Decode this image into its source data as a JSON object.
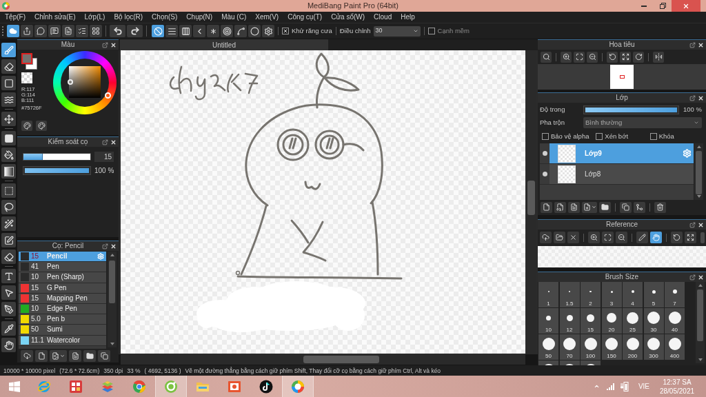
{
  "window": {
    "title": "MediBang Paint Pro (64bit)"
  },
  "menu": [
    "Tệp(F)",
    "Chỉnh sửa(E)",
    "Lớp(L)",
    "Bộ lọc(R)",
    "Chọn(S)",
    "Chụp(N)",
    "Màu (C)",
    "Xem(V)",
    "Công cụ(T)",
    "Cửa sổ(W)",
    "Cloud",
    "Help"
  ],
  "toolbar": {
    "snap_modes": [
      {
        "selected": true
      },
      {
        "selected": false
      },
      {
        "selected": false
      },
      {
        "selected": false
      },
      {
        "selected": false
      },
      {
        "selected": false
      },
      {
        "selected": false
      },
      {
        "selected": false
      },
      {
        "selected": false
      }
    ],
    "antialias": {
      "label": "Khử răng cưa",
      "checked": true
    },
    "correction": {
      "label": "Điều chỉnh",
      "value": "30"
    },
    "soft_edge": {
      "label": "Cạnh mềm",
      "checked": false
    }
  },
  "tools": [
    {
      "selected": true
    },
    {
      "selected": false
    },
    {
      "selected": false
    },
    {
      "selected": false
    },
    {
      "selected": false
    },
    {
      "selected": false
    },
    {
      "selected": false
    },
    {
      "selected": false
    },
    {
      "selected": false
    },
    {
      "selected": false
    },
    {
      "selected": false
    },
    {
      "selected": false
    },
    {
      "selected": false
    },
    {
      "selected": false
    },
    {
      "selected": false
    },
    {
      "selected": false
    },
    {
      "selected": false
    },
    {
      "selected": false
    }
  ],
  "color_panel": {
    "title": "Màu",
    "swatches": [
      {
        "kind": "foreground",
        "color": "#75726f",
        "selected": true
      },
      {
        "kind": "background",
        "color": "#ffffff",
        "selected": false
      }
    ],
    "red": "R:117",
    "green": "G:114",
    "blue": "B:111",
    "hex": "#75726F"
  },
  "brush_control": {
    "title": "Kiểm soát cọ",
    "size": {
      "level": 0.29,
      "value": "15"
    },
    "opacity": {
      "level": 1,
      "reading": "100 %"
    }
  },
  "brush_panel": {
    "title": "Cọ: Pencil",
    "brushes": [
      {
        "size": "15",
        "name": "Pencil",
        "color": "#2a2a2a",
        "selected": true
      },
      {
        "size": "41",
        "name": "Pen",
        "color": "#2a2a2a",
        "selected": false
      },
      {
        "size": "10",
        "name": "Pen (Sharp)",
        "color": "#2a2a2a",
        "selected": false
      },
      {
        "size": "15",
        "name": "G Pen",
        "color": "#ee3333",
        "selected": false
      },
      {
        "size": "15",
        "name": "Mapping Pen",
        "color": "#ee3333",
        "selected": false
      },
      {
        "size": "10",
        "name": "Edge Pen",
        "color": "#22aa22",
        "selected": false
      },
      {
        "size": "5.0",
        "name": "Pen b",
        "color": "#f2d800",
        "selected": false
      },
      {
        "size": "50",
        "name": "Sumi",
        "color": "#f2d800",
        "selected": false
      },
      {
        "size": "11.1",
        "name": "Watercolor",
        "color": "#7ad4f4",
        "selected": false
      }
    ]
  },
  "canvas": {
    "tab": "Untitled"
  },
  "navigator": {
    "title": "Hoa tiêu"
  },
  "layers": {
    "title": "Lớp",
    "opacity": {
      "label": "Độ trong",
      "level": 1,
      "reading": "100 %"
    },
    "blend": {
      "label": "Pha trộn",
      "value": "Bình thường"
    },
    "options": [
      {
        "label": "Bảo vệ alpha",
        "checked": false
      },
      {
        "label": "Xén bớt",
        "checked": false
      },
      {
        "label": "Khóa",
        "checked": false
      }
    ],
    "items": [
      {
        "name": "Lớp9",
        "visible": true,
        "selected": true
      },
      {
        "name": "Lớp8",
        "visible": true,
        "selected": false
      }
    ]
  },
  "reference": {
    "title": "Reference",
    "tools": [
      {
        "selected": false
      },
      {
        "selected": false
      },
      {
        "selected": false
      },
      {
        "selected": false
      },
      {
        "selected": false
      },
      {
        "selected": false
      },
      {
        "selected": false
      },
      {
        "selected": true
      },
      {
        "selected": false
      },
      {
        "selected": false
      }
    ]
  },
  "brush_size": {
    "title": "Brush Size",
    "sizes": [
      "1",
      "1.5",
      "2",
      "3",
      "4",
      "5",
      "7",
      "10",
      "12",
      "15",
      "20",
      "25",
      "30",
      "40",
      "50",
      "70",
      "100",
      "150",
      "200",
      "300",
      "400"
    ]
  },
  "status_bar": [
    "10000 * 10000 pixel",
    "(72.6 * 72.6cm)",
    "350 dpi",
    "33 %",
    "( 4692, 5136 )",
    "Vẽ một đường thẳng bằng cách giữ phím Shift, Thay đổi cỡ cọ bằng cách giữ phím Ctrl, Alt và kéo"
  ],
  "taskbar": {
    "apps": [
      {
        "highlighted": false
      },
      {
        "highlighted": false
      },
      {
        "highlighted": false
      },
      {
        "highlighted": false
      },
      {
        "highlighted": true
      },
      {
        "highlighted": false
      },
      {
        "highlighted": false
      },
      {
        "highlighted": false
      },
      {
        "highlighted": true
      }
    ],
    "language": "VIE",
    "time": "12:37 SA",
    "date": "28/05/2021"
  }
}
